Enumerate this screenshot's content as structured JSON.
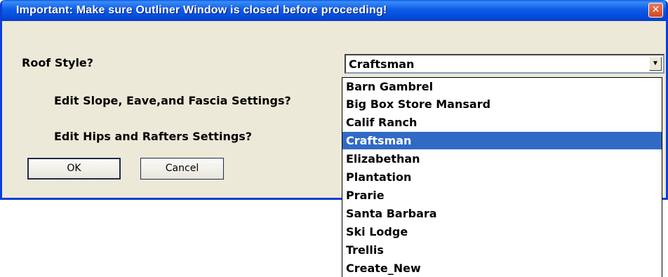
{
  "dialog": {
    "title": "Important:  Make sure Outliner Window is closed before proceeding!",
    "close_icon": "close-icon"
  },
  "form": {
    "roof_style_label": "Roof Style?",
    "edit_slope_label": "Edit  Slope, Eave,and Fascia Settings?",
    "edit_hips_label": "Edit  Hips and Rafters Settings?"
  },
  "roof_style_select": {
    "value": "Craftsman",
    "arrow_icon": "chevron-down-icon",
    "options": [
      "Barn Gambrel",
      "Big Box Store Mansard",
      "Calif Ranch",
      "Craftsman",
      "Elizabethan",
      "Plantation",
      "Prarie",
      "Santa Barbara",
      "Ski Lodge",
      "Trellis",
      "Create_New"
    ],
    "highlighted_index": 3
  },
  "buttons": {
    "ok_label": "OK",
    "cancel_label": "Cancel"
  },
  "colors": {
    "titlebar_blue": "#0a58ea",
    "dialog_face": "#ece9d8",
    "selection_blue": "#316ac5",
    "close_red": "#d6461e"
  }
}
